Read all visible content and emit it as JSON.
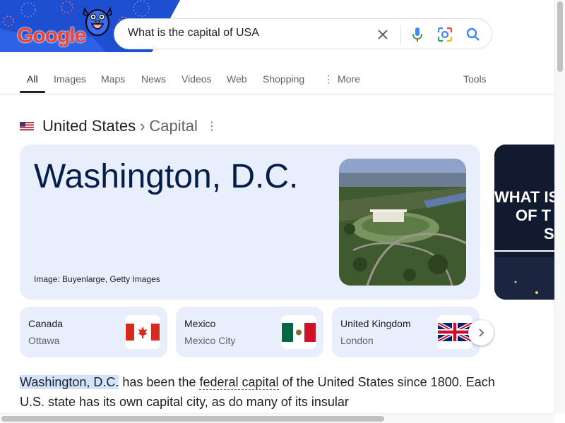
{
  "logo": {
    "text": "Google"
  },
  "search": {
    "query": "What is the capital of USA",
    "placeholder": ""
  },
  "tabs": [
    {
      "label": "All"
    },
    {
      "label": "Images"
    },
    {
      "label": "Maps"
    },
    {
      "label": "News"
    },
    {
      "label": "Videos"
    },
    {
      "label": "Web"
    },
    {
      "label": "Shopping"
    },
    {
      "label": "More"
    }
  ],
  "tools_label": "Tools",
  "knowledge_panel": {
    "entity": "United States",
    "separator": "›",
    "attribute": "Capital",
    "answer": "Washington, D.C.",
    "image_credit": "Image: Buyenlarge, Getty Images",
    "side_video_text": [
      "WHAT IS",
      "OF T",
      "S"
    ]
  },
  "related_countries": [
    {
      "name": "Canada",
      "capital": "Ottawa",
      "flag": "canada-flag"
    },
    {
      "name": "Mexico",
      "capital": "Mexico City",
      "flag": "mexico-flag"
    },
    {
      "name": "United Kingdom",
      "capital": "London",
      "flag": "uk-flag"
    }
  ],
  "description": {
    "highlight": "Washington, D.C.",
    "part1": " has been the ",
    "link": "federal capital",
    "part2": " of the United States since 1800. Each U.S. state has its own capital city, as do many of its insular"
  },
  "colors": {
    "accent": "#1a73e8",
    "card_bg": "#e8eefc",
    "answer_text": "#041e49"
  }
}
